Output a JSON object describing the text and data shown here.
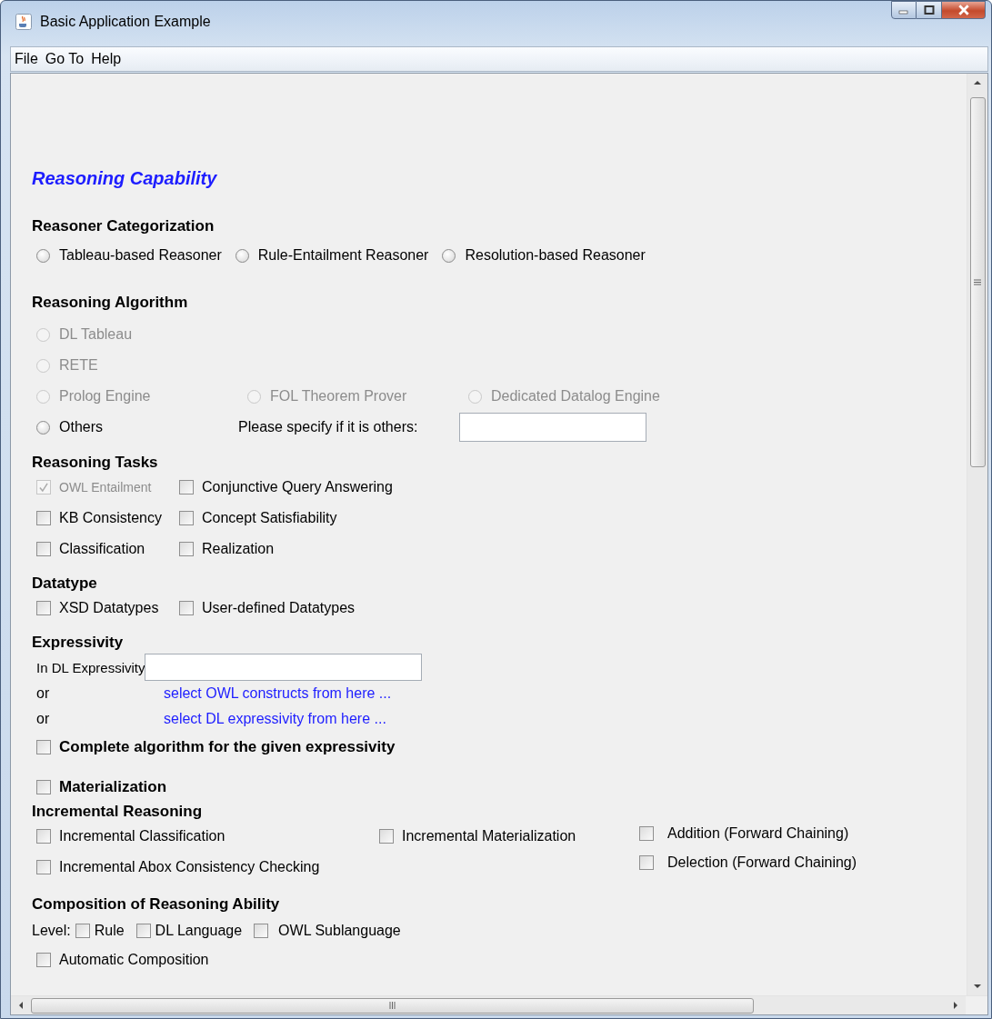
{
  "window": {
    "title": "Basic Application Example"
  },
  "menu": [
    {
      "label": "File"
    },
    {
      "label": "Go To"
    },
    {
      "label": "Help"
    }
  ],
  "heading": "Reasoning Capability",
  "categorization": {
    "title": "Reasoner Categorization",
    "options": [
      {
        "label": "Tableau-based Reasoner",
        "selected": false
      },
      {
        "label": "Rule-Entailment Reasoner",
        "selected": false
      },
      {
        "label": "Resolution-based Reasoner",
        "selected": false
      }
    ]
  },
  "algorithm": {
    "title": "Reasoning Algorithm",
    "rows": [
      [
        {
          "label": "DL Tableau",
          "selected": false,
          "disabled": true
        }
      ],
      [
        {
          "label": "RETE",
          "selected": false,
          "disabled": true
        }
      ],
      [
        {
          "label": "Prolog Engine",
          "selected": false,
          "disabled": true
        },
        {
          "label": "FOL Theorem Prover",
          "selected": false,
          "disabled": true
        },
        {
          "label": "Dedicated Datalog Engine",
          "selected": false,
          "disabled": true
        }
      ],
      [
        {
          "label": "Others",
          "selected": false,
          "disabled": false
        }
      ]
    ],
    "specify_label": "Please specify if it is others:"
  },
  "tasks": {
    "title": "Reasoning Tasks",
    "rows": [
      [
        {
          "label": "OWL Entailment",
          "checked": true,
          "disabled": true
        },
        {
          "label": "Conjunctive Query Answering",
          "checked": false,
          "disabled": false
        }
      ],
      [
        {
          "label": "KB Consistency",
          "checked": false,
          "disabled": false
        },
        {
          "label": "Concept Satisfiability",
          "checked": false,
          "disabled": false
        }
      ],
      [
        {
          "label": "Classification",
          "checked": false,
          "disabled": false
        },
        {
          "label": "Realization",
          "checked": false,
          "disabled": false
        }
      ]
    ]
  },
  "datatype": {
    "title": "Datatype",
    "options": [
      {
        "label": "XSD Datatypes",
        "checked": false
      },
      {
        "label": "User-defined Datatypes",
        "checked": false
      }
    ]
  },
  "expressivity": {
    "title": "Expressivity",
    "field_label": "In DL Expressivity",
    "links": [
      {
        "prefix": "or",
        "label": "select OWL constructs from here ..."
      },
      {
        "prefix": "or",
        "label": "select DL expressivity from here ..."
      }
    ],
    "complete": {
      "label": "Complete algorithm for the given expressivity",
      "checked": false
    }
  },
  "materialization": {
    "label": "Materialization",
    "checked": false
  },
  "incremental": {
    "title": "Incremental Reasoning",
    "columns": [
      [
        {
          "label": "Incremental Classification",
          "checked": false
        },
        {
          "label": "Incremental Abox Consistency Checking",
          "checked": false
        }
      ],
      [
        {
          "label": "Incremental Materialization",
          "checked": false
        }
      ],
      [
        {
          "label": "Addition (Forward Chaining)",
          "checked": false
        },
        {
          "label": "Delection (Forward Chaining)",
          "checked": false
        }
      ]
    ]
  },
  "composition": {
    "title": "Composition of Reasoning Ability",
    "level_label": "Level:",
    "levels": [
      {
        "label": "Rule",
        "checked": false
      },
      {
        "label": "DL Language",
        "checked": false
      },
      {
        "label": "OWL Sublanguage",
        "checked": false
      }
    ],
    "automatic": {
      "label": "Automatic Composition",
      "checked": false
    }
  }
}
